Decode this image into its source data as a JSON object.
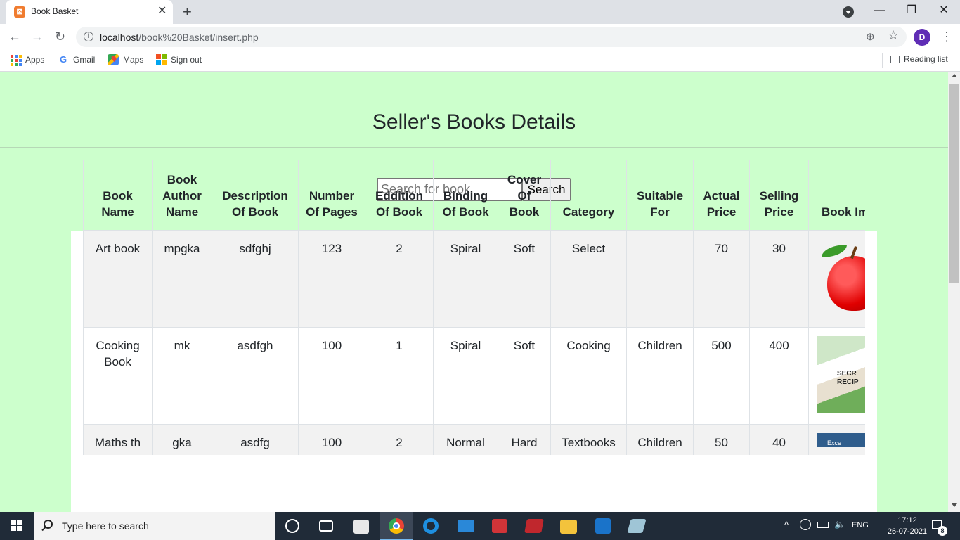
{
  "browser": {
    "tab_title": "Book Basket",
    "tab_favicon": "xampp-icon",
    "tab_close": "✕",
    "new_tab": "+",
    "url_host": "localhost",
    "url_path": "/book%20Basket/insert.php",
    "avatar_initial": "D",
    "window_minimize": "—",
    "window_restore": "❐",
    "window_close": "✕"
  },
  "bookmarks": {
    "items": [
      {
        "label": "Apps",
        "icon": "apps-grid-icon"
      },
      {
        "label": "Gmail",
        "icon": "google-icon"
      },
      {
        "label": "Maps",
        "icon": "maps-icon"
      },
      {
        "label": "Sign out",
        "icon": "microsoft-icon"
      }
    ],
    "reading_list": "Reading list"
  },
  "page": {
    "title": "Seller's Books Details",
    "background_color": "#ccffcc",
    "search": {
      "placeholder": "Search for book",
      "button_label": "Search"
    }
  },
  "table": {
    "headers": [
      "Book Name",
      "Book Author Name",
      "Description Of Book",
      "Number Of Pages",
      "Eddition Of Book",
      "Binding Of Book",
      "Cover Of Book",
      "Category",
      "Suitable For",
      "Actual Price",
      "Selling Price",
      "Book Image"
    ],
    "rows": [
      [
        "Art book",
        "mpgka",
        "sdfghj",
        "123",
        "2",
        "Spiral",
        "Soft",
        "Select",
        "",
        "70",
        "30"
      ],
      [
        "Cooking Book",
        "mk",
        "asdfgh",
        "100",
        "1",
        "Spiral",
        "Soft",
        "Cooking",
        "Children",
        "500",
        "400"
      ],
      [
        "Maths th",
        "gka",
        "asdfg",
        "100",
        "2",
        "Normal",
        "Hard",
        "Textbooks",
        "Children",
        "50",
        "40"
      ]
    ],
    "images": [
      "apple-image",
      "recipe-book-cover",
      "excel-book-cover"
    ],
    "recipe_cover_text": [
      "SECR",
      "RECIP"
    ],
    "excel_cover_text": "Exce"
  },
  "taskbar": {
    "search_placeholder": "Type here to search",
    "language": "ENG",
    "time": "17:12",
    "date": "26-07-2021",
    "notification_count": "8"
  }
}
